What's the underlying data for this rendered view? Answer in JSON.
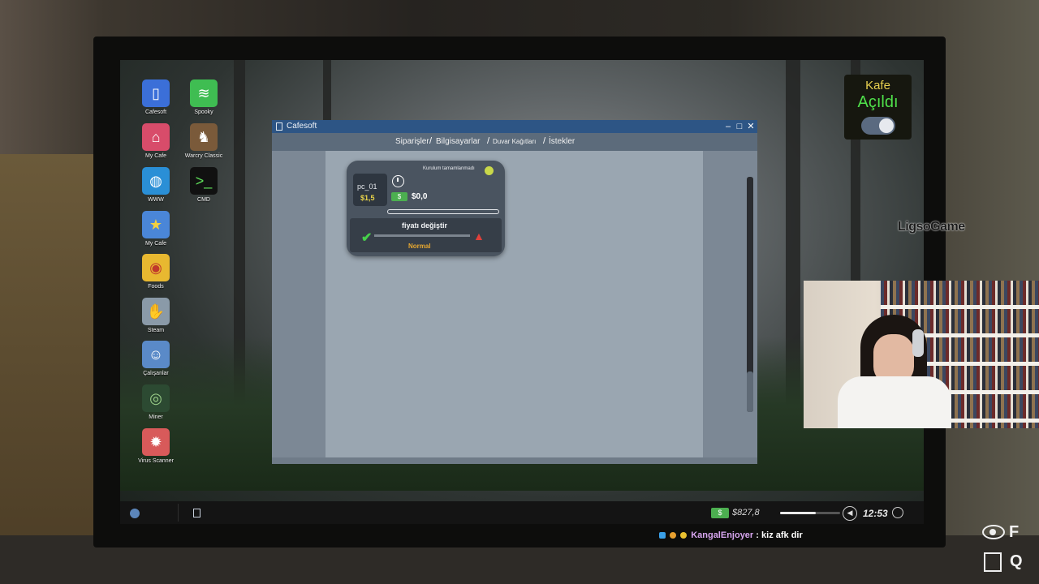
{
  "desktop": {
    "icons": [
      {
        "label": "Cafesoft",
        "icon": "cafesoft-icon",
        "color": "#3b6fd8"
      },
      {
        "label": "Spooky",
        "icon": "spooky-icon",
        "color": "#3fbd52"
      },
      {
        "label": "My Cafe",
        "icon": "my-cafe-icon",
        "color": "#d84c6a"
      },
      {
        "label": "Warcry Classic",
        "icon": "warcry-icon",
        "color": "#7a5a3a"
      },
      {
        "label": "WWW",
        "icon": "globe-icon",
        "color": "#2a8fd6"
      },
      {
        "label": "CMD",
        "icon": "terminal-icon",
        "color": "#111111"
      },
      {
        "label": "My Cafe",
        "icon": "star-icon",
        "color": "#4a86d8"
      },
      {
        "label": "Foods",
        "icon": "burger-icon",
        "color": "#e8b830"
      },
      {
        "label": "Steam",
        "icon": "handshake-icon",
        "color": "#8a9aa8"
      },
      {
        "label": "Çalışanlar",
        "icon": "employee-icon",
        "color": "#5a8ac8"
      },
      {
        "label": "Miner",
        "icon": "miner-icon",
        "color": "#2c4a32"
      },
      {
        "label": "Virus Scanner",
        "icon": "virus-icon",
        "color": "#d85a5a"
      }
    ]
  },
  "cafe": {
    "title": "Kafe",
    "status": "Açıldı",
    "open": true
  },
  "window": {
    "title": "Cafesoft",
    "nav": [
      "Siparişler",
      "Bilgisayarlar",
      "Duvar Kağıtları",
      "İstekler"
    ],
    "minimize": "–",
    "maximize": "□",
    "close": "✕"
  },
  "pc_card": {
    "name": "pc_01",
    "price": "$1,5",
    "status": "Kurulum tamamlanmadı",
    "money": "$0,0",
    "money_icon": "$",
    "price_panel": {
      "title": "fiyatı değiştir",
      "down": "⌄",
      "up": "⌃",
      "level": "Normal"
    }
  },
  "taskbar": {
    "money": "$827,8",
    "money_icon": "$",
    "volume": 0.6,
    "time": "12:53"
  },
  "chat": {
    "user": "KangalEnjoyer",
    "separator": ":",
    "message": "kiz afk dir"
  },
  "brand": "LigsoGame",
  "hotkeys": {
    "view": "F",
    "exit": "Q"
  }
}
